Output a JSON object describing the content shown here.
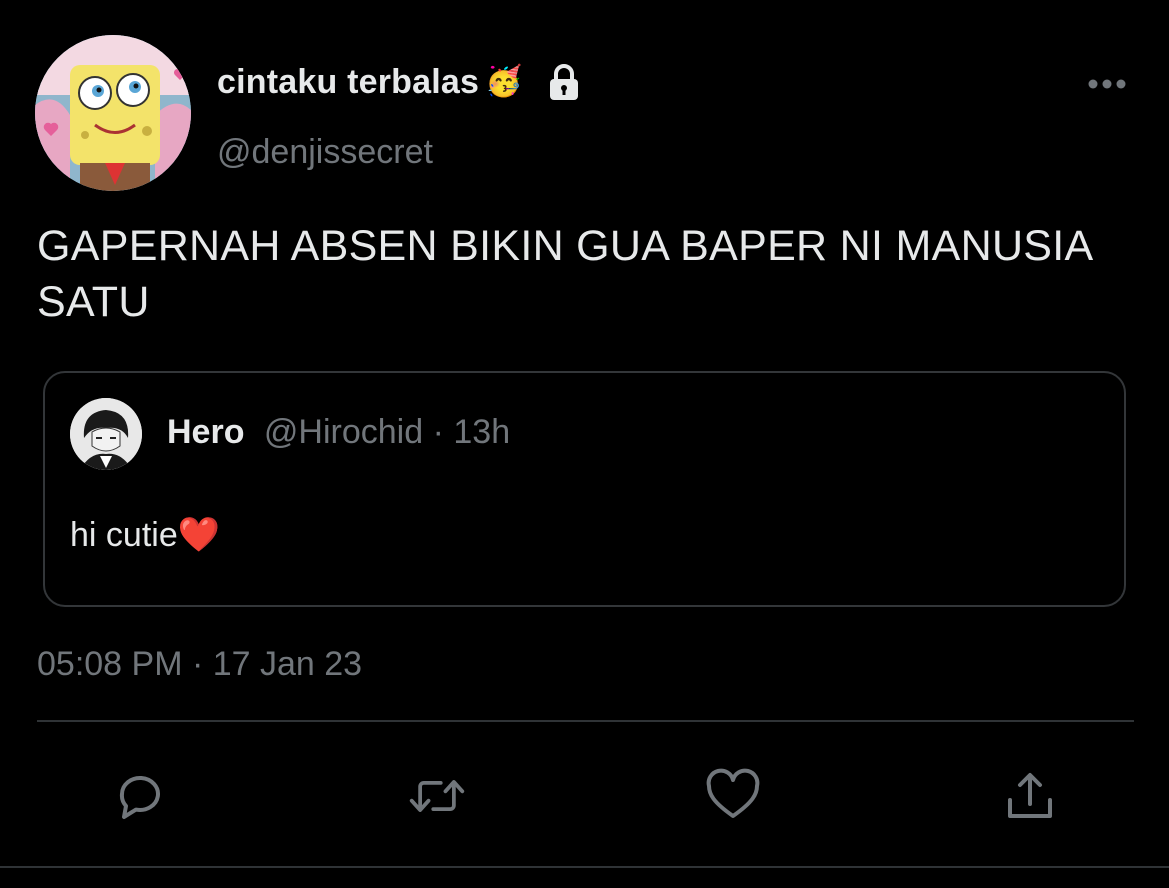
{
  "author": {
    "display_name": "cintaku terbalas",
    "display_name_emoji": "🥳",
    "protected_icon": "lock-icon",
    "handle": "@denjissecret",
    "avatar_icon": "avatar-cartoon"
  },
  "tweet": {
    "text": "GAPERNAH ABSEN BIKIN GUA BAPER NI MANUSIA SATU",
    "timestamp": "05:08 PM · 17 Jan 23"
  },
  "quoted_tweet": {
    "name": "Hero",
    "handle": "@Hirochid",
    "separator": " · ",
    "time": "13h",
    "text": "hi cutie",
    "text_emoji": "❤️"
  },
  "actions": [
    {
      "icon": "reply-icon"
    },
    {
      "icon": "retweet-icon"
    },
    {
      "icon": "like-icon"
    },
    {
      "icon": "share-icon"
    }
  ],
  "more_icon": "more-horizontal-icon",
  "colors": {
    "background": "#000000",
    "primary_text": "#e7e9ea",
    "secondary_text": "#71767b",
    "border": "#333639",
    "icon": "#71767b"
  }
}
